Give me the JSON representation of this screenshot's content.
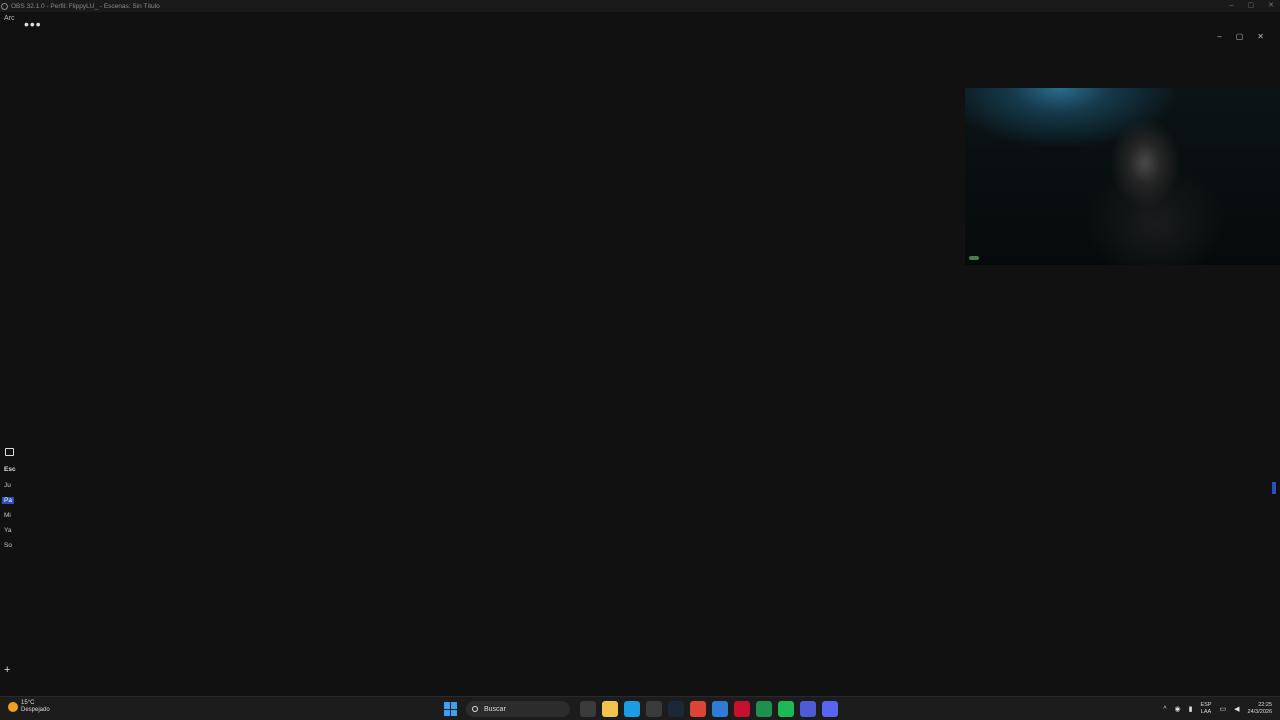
{
  "window": {
    "title": "OBS 32.1.0 - Perfil: FlippyLU_ - Escenas: Sin Título",
    "controls": [
      "–",
      "▢",
      "✕"
    ]
  },
  "inner": {
    "menu_label": "Arc",
    "more_label": "•••",
    "controls": [
      "–",
      "▢",
      "✕"
    ]
  },
  "scenes": {
    "header": "Esc",
    "items": [
      "Ju",
      "Pa",
      "Mi",
      "Ya",
      "So"
    ],
    "selected_index": 1,
    "add_label": "+"
  },
  "taskbar": {
    "weather": {
      "temp": "15°C",
      "condition": "Despejado"
    },
    "search_placeholder": "Buscar",
    "apps": [
      {
        "name": "task-view-icon",
        "color": "#3b3b3b"
      },
      {
        "name": "file-explorer-icon",
        "color": "#f2c14e"
      },
      {
        "name": "edge-icon",
        "color": "#1b9de2"
      },
      {
        "name": "store-icon",
        "color": "#3b3b3b"
      },
      {
        "name": "steam-icon",
        "color": "#1b2838"
      },
      {
        "name": "chrome-icon",
        "color": "#db4437"
      },
      {
        "name": "mail-icon",
        "color": "#2f7bd6"
      },
      {
        "name": "opera-icon",
        "color": "#c8102e"
      },
      {
        "name": "excel-icon",
        "color": "#1f8f4e"
      },
      {
        "name": "spotify-icon",
        "color": "#1db954"
      },
      {
        "name": "app-icon",
        "color": "#4d5bd6"
      },
      {
        "name": "discord-icon",
        "color": "#5865f2"
      }
    ],
    "tray": {
      "lang_top": "ESP",
      "lang_bottom": "LAA",
      "time": "22:25",
      "date": "24/3/2026"
    }
  },
  "colors": {
    "accent": "#2e4fb8",
    "background": "#111111"
  }
}
